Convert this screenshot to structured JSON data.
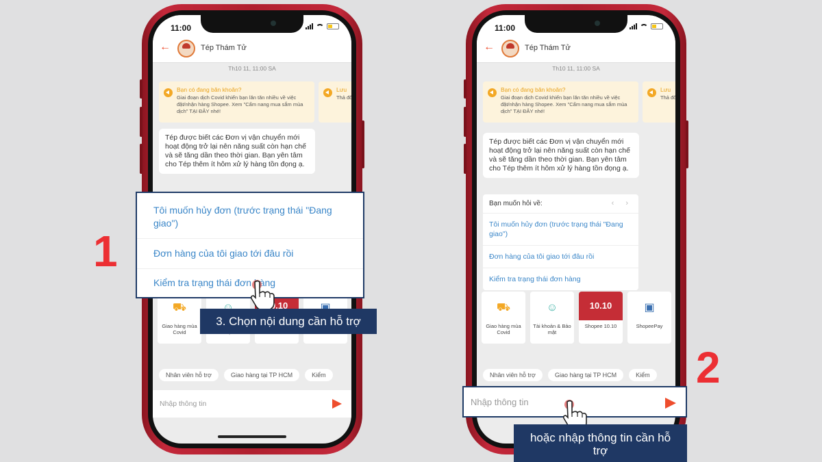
{
  "phone": {
    "time": "11:00",
    "contact_name": "Tép Thám Tử",
    "date_stamp": "Th10 11, 11:00 SA",
    "notice_title": "Bạn có đang băn khoăn?",
    "notice_body": "Giai đoạn dịch Covid khiến bạn lăn tăn nhiều về việc đặt/nhận hàng Shopee. Xem \"Cẩm nang mua sắm mùa dịch\" TẠI ĐÂY nhé!",
    "notice2_title": "Lưu",
    "notice2_body": "Thả đổi",
    "bot_message": "Tép được biết các Đơn vị vận chuyển mới hoạt động trở lại nên năng suất còn hạn chế và sẽ tăng dần theo thời gian. Bạn yên tâm cho Tép thêm ít hôm xử lý hàng tồn đọng ạ.",
    "menu_title": "Bạn muốn hỏi về:",
    "menu_nav": "‹ ›",
    "menu_items": [
      "Tôi muốn hủy đơn (trước trạng thái \"Đang giao\")",
      "Đơn hàng của tôi giao tới đâu rồi",
      "Kiểm tra trạng thái đơn hàng"
    ],
    "categories": [
      {
        "label": "Giao hàng mùa Covid",
        "icon": "truck-icon"
      },
      {
        "label": "Tài khoản & Bảo mật",
        "icon": "user-icon"
      },
      {
        "label": "Shopee 10.10",
        "icon": "promo-banner",
        "banner": "10.10"
      },
      {
        "label": "ShopeePay",
        "icon": "shopeepay-icon"
      }
    ],
    "chips": [
      "Nhân viên hỗ trợ",
      "Giao hàng tại TP HCM",
      "Kiểm"
    ],
    "input_placeholder": "Nhập thông tin"
  },
  "annotations": {
    "step1_number": "1",
    "step2_number": "2",
    "step1_label": "3. Chọn nội dung cần hỗ trợ",
    "step2_label": "hoặc nhập thông tin cần hỗ trợ"
  },
  "colors": {
    "phone_body": "#b0202f",
    "shopee_orange": "#ee4d2d",
    "link_blue": "#3a86c8",
    "label_navy": "#1f3864",
    "step_red": "#ec2f33"
  }
}
